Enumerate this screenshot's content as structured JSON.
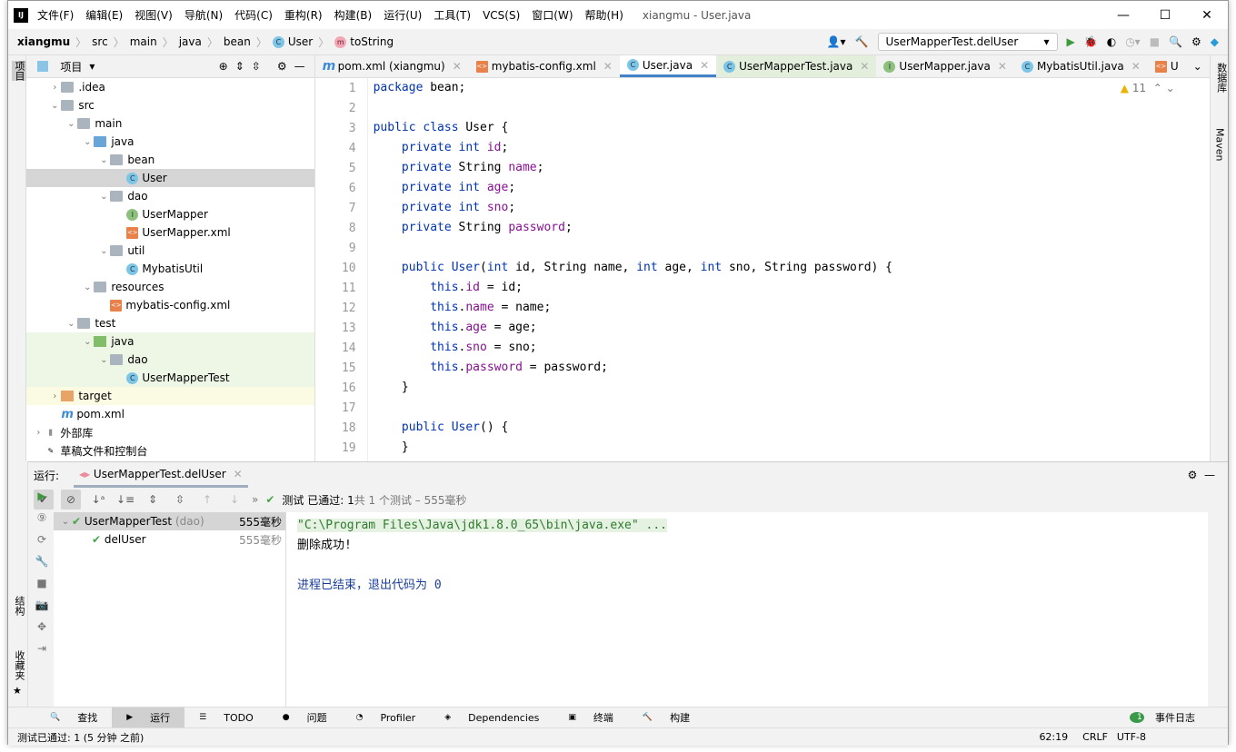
{
  "window": {
    "title": "xiangmu - User.java",
    "menu": [
      "文件(F)",
      "编辑(E)",
      "视图(V)",
      "导航(N)",
      "代码(C)",
      "重构(R)",
      "构建(B)",
      "运行(U)",
      "工具(T)",
      "VCS(S)",
      "窗口(W)",
      "帮助(H)"
    ]
  },
  "breadcrumb": [
    "xiangmu",
    "src",
    "main",
    "java",
    "bean",
    "User",
    "toString"
  ],
  "run_config": "UserMapperTest.delUser",
  "left_strip": {
    "project": "项目",
    "structure": "结构",
    "favorites": "收藏夹"
  },
  "right_strip": {
    "database": "数据库",
    "maven": "Maven"
  },
  "project_panel": {
    "title": "项目",
    "tree": [
      {
        "label": ".idea",
        "depth": 1,
        "arrow": "right",
        "icon": "folder"
      },
      {
        "label": "src",
        "depth": 1,
        "arrow": "down",
        "icon": "folder"
      },
      {
        "label": "main",
        "depth": 2,
        "arrow": "down",
        "icon": "folder"
      },
      {
        "label": "java",
        "depth": 3,
        "arrow": "down",
        "icon": "source-folder"
      },
      {
        "label": "bean",
        "depth": 4,
        "arrow": "down",
        "icon": "package"
      },
      {
        "label": "User",
        "depth": 5,
        "arrow": "",
        "icon": "class",
        "selected": true
      },
      {
        "label": "dao",
        "depth": 4,
        "arrow": "down",
        "icon": "package"
      },
      {
        "label": "UserMapper",
        "depth": 5,
        "arrow": "",
        "icon": "interface"
      },
      {
        "label": "UserMapper.xml",
        "depth": 5,
        "arrow": "",
        "icon": "xml"
      },
      {
        "label": "util",
        "depth": 4,
        "arrow": "down",
        "icon": "package"
      },
      {
        "label": "MybatisUtil",
        "depth": 5,
        "arrow": "",
        "icon": "class"
      },
      {
        "label": "resources",
        "depth": 3,
        "arrow": "down",
        "icon": "resources-folder"
      },
      {
        "label": "mybatis-config.xml",
        "depth": 4,
        "arrow": "",
        "icon": "xml"
      },
      {
        "label": "test",
        "depth": 2,
        "arrow": "down",
        "icon": "folder"
      },
      {
        "label": "java",
        "depth": 3,
        "arrow": "down",
        "icon": "test-folder",
        "hl": "green"
      },
      {
        "label": "dao",
        "depth": 4,
        "arrow": "down",
        "icon": "package",
        "hl": "green"
      },
      {
        "label": "UserMapperTest",
        "depth": 5,
        "arrow": "",
        "icon": "test-class",
        "hl": "green"
      },
      {
        "label": "target",
        "depth": 1,
        "arrow": "right",
        "icon": "excluded-folder",
        "hl": "yellow"
      },
      {
        "label": "pom.xml",
        "depth": 1,
        "arrow": "",
        "icon": "maven"
      },
      {
        "label": "外部库",
        "depth": 0,
        "arrow": "right",
        "icon": "library"
      },
      {
        "label": "草稿文件和控制台",
        "depth": 0,
        "arrow": "",
        "icon": "scratch"
      }
    ]
  },
  "editor": {
    "tabs": [
      {
        "label": "pom.xml (xiangmu)",
        "icon": "maven"
      },
      {
        "label": "mybatis-config.xml",
        "icon": "xml"
      },
      {
        "label": "User.java",
        "icon": "class",
        "active": true
      },
      {
        "label": "UserMapperTest.java",
        "icon": "test-class",
        "test": true
      },
      {
        "label": "UserMapper.java",
        "icon": "interface"
      },
      {
        "label": "MybatisUtil.java",
        "icon": "class"
      },
      {
        "label": "U",
        "icon": "xml"
      }
    ],
    "warnings": "11",
    "code": [
      [
        [
          "package ",
          "kw"
        ],
        [
          "bean;",
          ""
        ]
      ],
      [],
      [
        [
          "public class ",
          "kw"
        ],
        [
          "User {",
          ""
        ]
      ],
      [
        [
          "    private int ",
          "kw"
        ],
        [
          "id",
          "fld"
        ],
        [
          ";",
          ""
        ]
      ],
      [
        [
          "    private ",
          "kw"
        ],
        [
          "String ",
          ""
        ],
        [
          "name",
          "fld"
        ],
        [
          ";",
          ""
        ]
      ],
      [
        [
          "    private int ",
          "kw"
        ],
        [
          "age",
          "fld"
        ],
        [
          ";",
          ""
        ]
      ],
      [
        [
          "    private int ",
          "kw"
        ],
        [
          "sno",
          "fld"
        ],
        [
          ";",
          ""
        ]
      ],
      [
        [
          "    private ",
          "kw"
        ],
        [
          "String ",
          ""
        ],
        [
          "password",
          "fld"
        ],
        [
          ";",
          ""
        ]
      ],
      [],
      [
        [
          "    public ",
          "kw"
        ],
        [
          "User",
          "kw"
        ],
        [
          "(",
          ""
        ],
        [
          "int ",
          "kw"
        ],
        [
          "id, String name, ",
          ""
        ],
        [
          "int ",
          "kw"
        ],
        [
          "age, ",
          ""
        ],
        [
          "int ",
          "kw"
        ],
        [
          "sno, String password) {",
          ""
        ]
      ],
      [
        [
          "        this",
          "kw"
        ],
        [
          ".",
          ""
        ],
        [
          "id",
          "fld"
        ],
        [
          " = id;",
          ""
        ]
      ],
      [
        [
          "        this",
          "kw"
        ],
        [
          ".",
          ""
        ],
        [
          "name",
          "fld"
        ],
        [
          " = name;",
          ""
        ]
      ],
      [
        [
          "        this",
          "kw"
        ],
        [
          ".",
          ""
        ],
        [
          "age",
          "fld"
        ],
        [
          " = age;",
          ""
        ]
      ],
      [
        [
          "        this",
          "kw"
        ],
        [
          ".",
          ""
        ],
        [
          "sno",
          "fld"
        ],
        [
          " = sno;",
          ""
        ]
      ],
      [
        [
          "        this",
          "kw"
        ],
        [
          ".",
          ""
        ],
        [
          "password",
          "fld"
        ],
        [
          " = password;",
          ""
        ]
      ],
      [
        [
          "    }",
          ""
        ]
      ],
      [],
      [
        [
          "    public ",
          "kw"
        ],
        [
          "User",
          "kw"
        ],
        [
          "() {",
          ""
        ]
      ],
      [
        [
          "    }",
          ""
        ]
      ]
    ]
  },
  "run": {
    "label": "运行:",
    "tab": "UserMapperTest.delUser",
    "status_pass": "测试 已通过: 1",
    "status_rest": "共 1 个测试 – 555毫秒",
    "tests": [
      {
        "name": "UserMapperTest",
        "pkg": "(dao)",
        "time": "555毫秒"
      },
      {
        "name": "delUser",
        "time": "555毫秒"
      }
    ],
    "console": [
      "\"C:\\Program Files\\Java\\jdk1.8.0_65\\bin\\java.exe\" ...",
      "删除成功!",
      "",
      "进程已结束，退出代码为 0"
    ]
  },
  "bottom_tools": [
    "查找",
    "运行",
    "TODO",
    "问题",
    "Profiler",
    "Dependencies",
    "终端",
    "构建"
  ],
  "event_log": "事件日志",
  "status": {
    "message": "测试已通过: 1 (5 分钟 之前)",
    "position": "62:19",
    "line_sep": "CRLF",
    "encoding": "UTF-8"
  }
}
